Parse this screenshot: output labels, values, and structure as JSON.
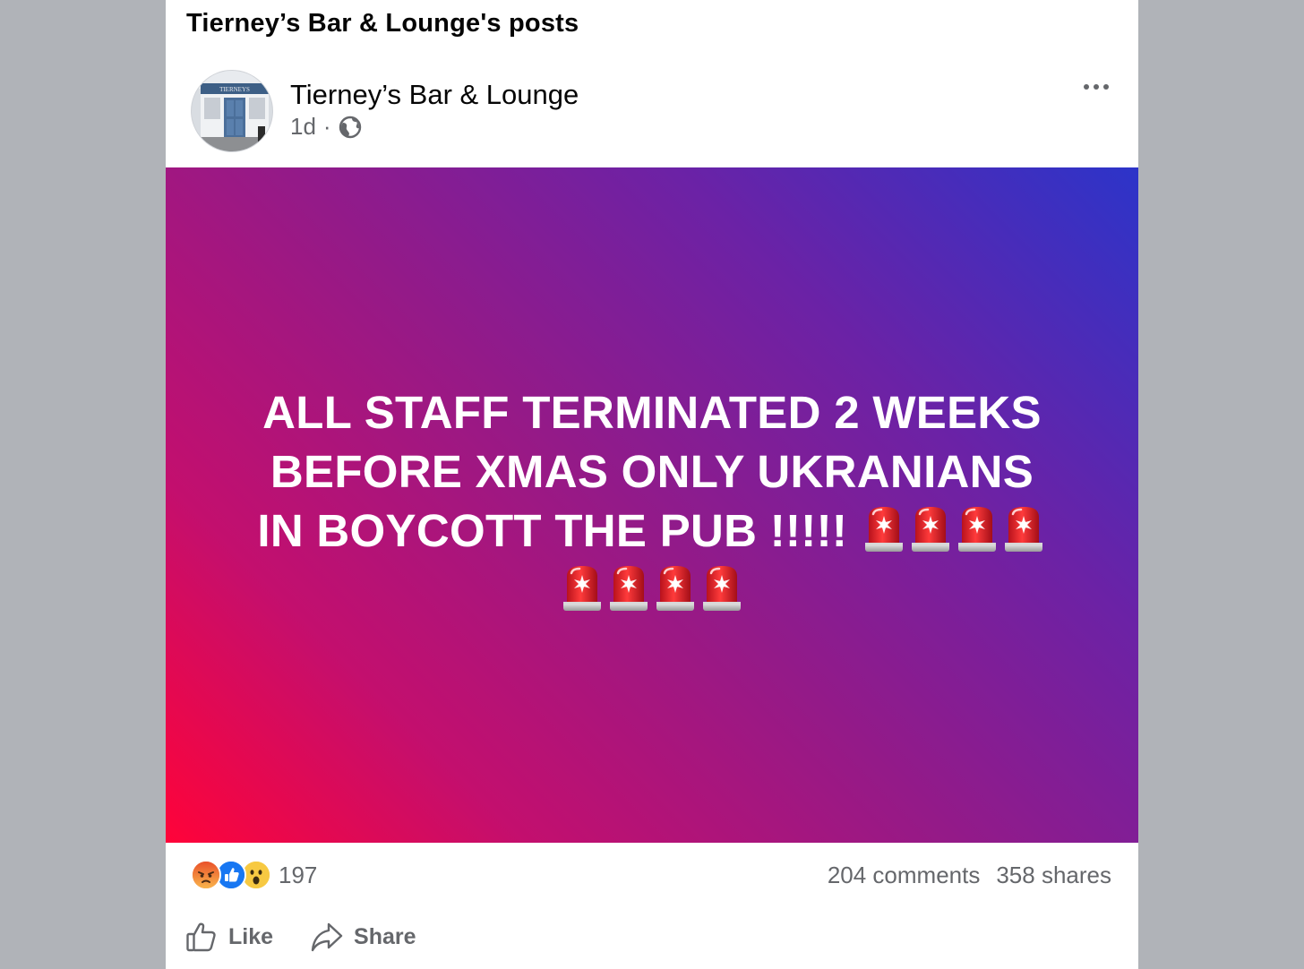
{
  "page": {
    "header_title": "Tierney’s Bar & Lounge's posts"
  },
  "post": {
    "author": "Tierney’s Bar & Lounge",
    "timestamp": "1d",
    "separator": "·",
    "audience_icon": "globe-icon",
    "avatar_sign_text": "TIERNEYS",
    "more_icon": "more-options-icon",
    "banner": {
      "line_1": "ALL STAFF TERMINATED 2 WEEKS",
      "line_2": "BEFORE XMAS ONLY UKRANIANS",
      "line_3": "IN BOYCOTT THE PUB !!!!!",
      "emoji": "police-siren-emoji",
      "emoji_count_line_3": 4,
      "emoji_count_line_4": 4,
      "gradient_colors": [
        "#ff0339",
        "#941a88",
        "#2c34c9"
      ]
    },
    "reactions": {
      "icons": [
        "angry-reaction-icon",
        "like-reaction-icon",
        "wow-reaction-icon"
      ],
      "count": "197"
    },
    "comments_label": "204 comments",
    "shares_label": "358 shares",
    "actions": {
      "like_label": "Like",
      "share_label": "Share"
    }
  },
  "colors": {
    "background": "#b0b3b8",
    "card": "#ffffff",
    "secondary_text": "#65676b",
    "primary_text": "#050505",
    "like_blue": "#1877f2"
  }
}
